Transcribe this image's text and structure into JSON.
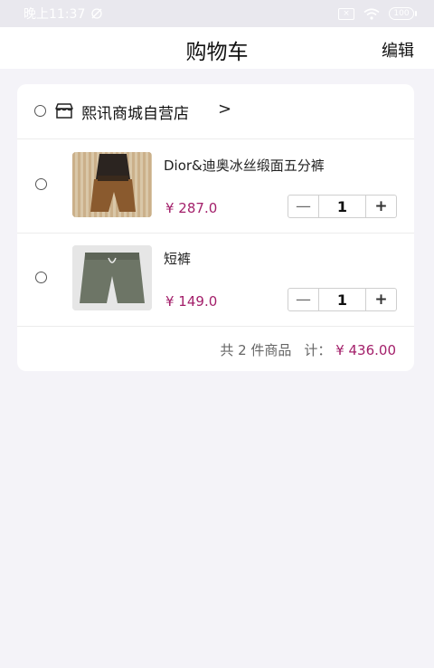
{
  "status_bar": {
    "time": "晚上11:37",
    "battery": "100",
    "sim_text": "×"
  },
  "nav": {
    "title": "购物车",
    "edit_label": "编辑"
  },
  "shop": {
    "name": "熙讯商城自营店",
    "chevron": ">"
  },
  "items": [
    {
      "name": "Dior&迪奥冰丝缎面五分裤",
      "price": "¥ 287.0",
      "qty": "1",
      "minus": "—",
      "plus": "+"
    },
    {
      "name": "短裤",
      "price": "¥ 149.0",
      "qty": "1",
      "minus": "—",
      "plus": "+"
    }
  ],
  "summary": {
    "count_text": "共 2 件商品",
    "total_label": "计：",
    "total_price": "¥ 436.00"
  },
  "colors": {
    "price": "#a31f6a",
    "background": "#f4f3f8"
  }
}
